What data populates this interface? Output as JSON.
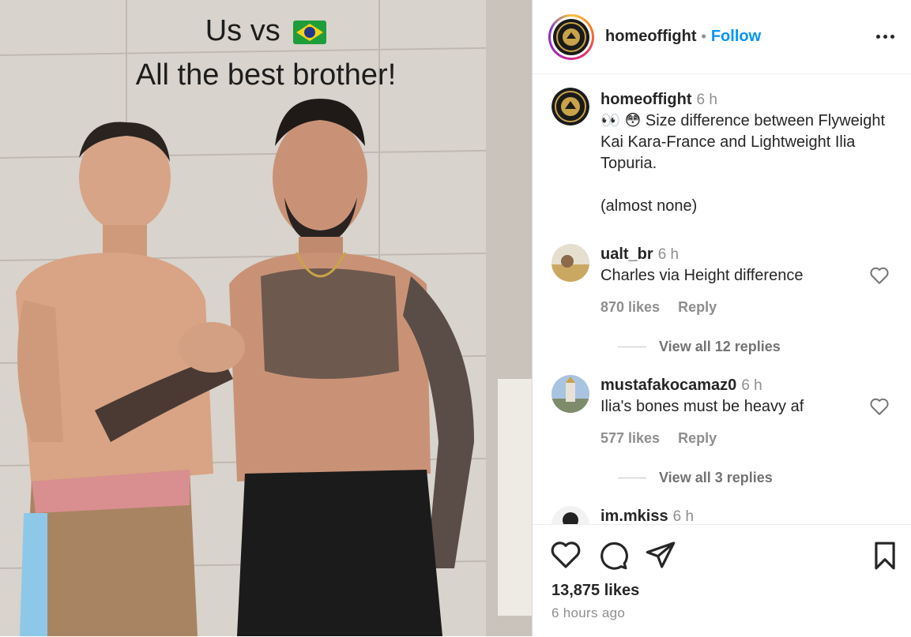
{
  "photo": {
    "overlay_line1": "Us vs",
    "flag_icon": "brazil-flag-icon",
    "overlay_line2": "All the best brother!"
  },
  "header": {
    "username": "homeoffight",
    "separator": "•",
    "follow_label": "Follow",
    "more_icon": "more-options-icon"
  },
  "caption": {
    "username": "homeoffight",
    "time": "6 h",
    "emojis": "👀 😳",
    "text": "Size difference between Flyweight Kai Kara-France and Lightweight Ilia Topuria.",
    "text2": "(almost none)"
  },
  "comments": [
    {
      "username": "ualt_br",
      "time": "6 h",
      "text": "Charles via Height difference",
      "likes": "870 likes",
      "reply": "Reply",
      "view_replies": "View all 12 replies"
    },
    {
      "username": "mustafakocamaz0",
      "time": "6 h",
      "text": "Ilia's bones must be heavy af",
      "likes": "577 likes",
      "reply": "Reply",
      "view_replies": "View all 3 replies"
    },
    {
      "username": "im.mkiss",
      "time": "6 h"
    }
  ],
  "footer": {
    "likes": "13,875 likes",
    "time_ago": "6 hours ago"
  },
  "colors": {
    "accent": "#0095f6",
    "text": "#262626",
    "muted": "#8e8e8e"
  }
}
